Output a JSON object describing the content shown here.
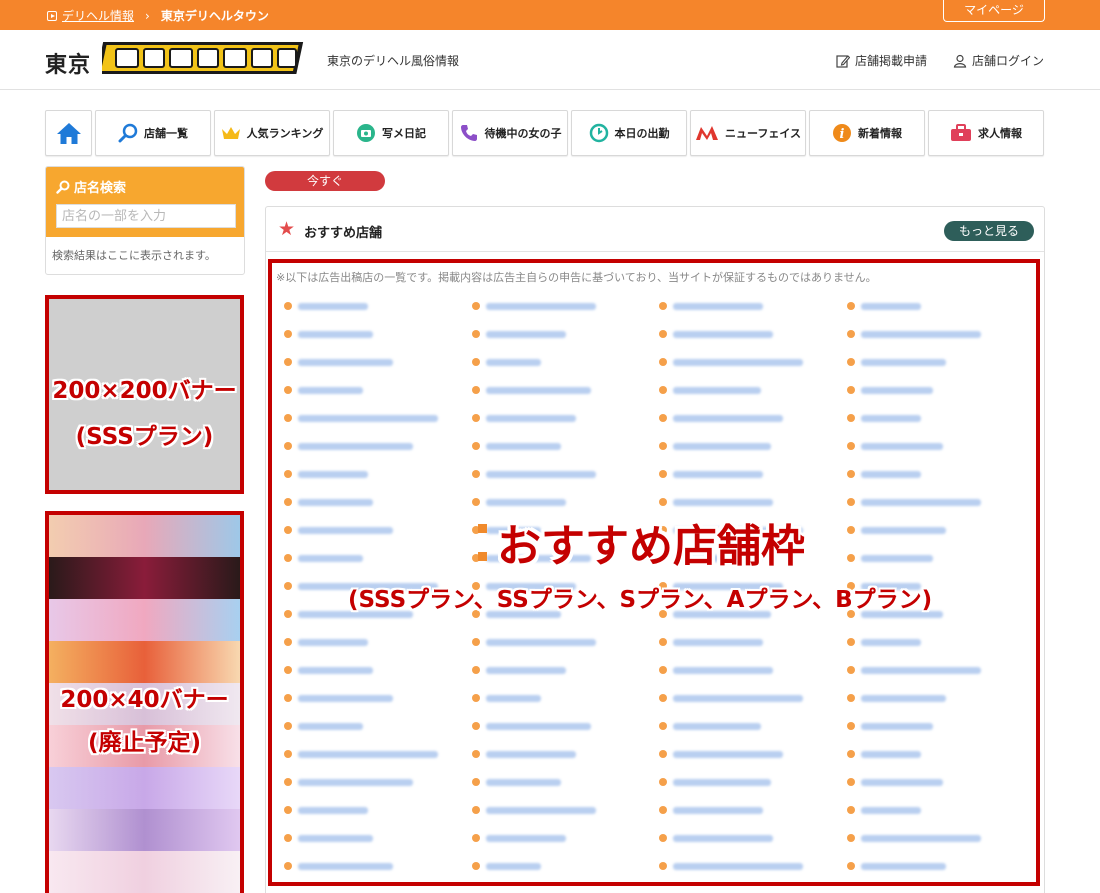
{
  "breadcrumb": {
    "items": [
      "デリヘル情報",
      "東京デリヘルタウン"
    ]
  },
  "mypage_label": "マイページ",
  "header": {
    "logo_word": "東京",
    "tagline": "東京のデリヘル風俗情報",
    "links": [
      "店舗掲載申請",
      "店舗ログイン"
    ]
  },
  "nav": {
    "items": [
      {
        "label": "店舗一覧",
        "icon": "search-icon"
      },
      {
        "label": "人気ランキング",
        "icon": "crown-icon"
      },
      {
        "label": "写メ日記",
        "icon": "camera-icon"
      },
      {
        "label": "待機中の女の子",
        "icon": "phone-icon"
      },
      {
        "label": "本日の出勤",
        "icon": "clock-icon"
      },
      {
        "label": "ニューフェイス",
        "icon": "new-face-icon"
      },
      {
        "label": "新着情報",
        "icon": "info-icon"
      },
      {
        "label": "求人情報",
        "icon": "briefcase-icon"
      }
    ]
  },
  "search": {
    "title": "店名検索",
    "placeholder": "店名の一部を入力",
    "result_text": "検索結果はここに表示されます。"
  },
  "banners": {
    "big_label_1": "200×200バナー",
    "big_label_2": "(SSSプラン)",
    "small_label_1": "200×40バナー",
    "small_label_2": "(廃止予定)"
  },
  "now_label": "今すぐ",
  "recommend": {
    "title": "おすすめ店舗",
    "more_label": "もっと見る",
    "notice": "※以下は広告出稿店の一覧です。掲載内容は広告主自らの申告に基づいており、当サイトが保証するものではありません。",
    "overlay_title": "おすすめ店舗枠",
    "overlay_sub": "(SSSプラン、SSプラン、Sプラン、Aプラン、Bプラン)"
  },
  "colors": {
    "accent": "#f5852b",
    "frame": "#c40000",
    "link": "#2a6ad6"
  }
}
